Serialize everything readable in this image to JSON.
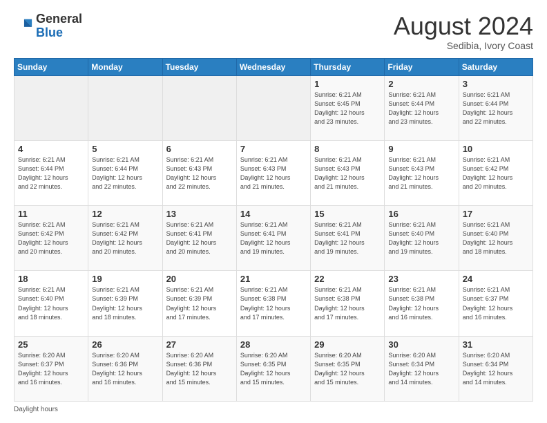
{
  "header": {
    "logo_general": "General",
    "logo_blue": "Blue",
    "month_year": "August 2024",
    "location": "Sedibia, Ivory Coast"
  },
  "footer": {
    "daylight_label": "Daylight hours"
  },
  "days_of_week": [
    "Sunday",
    "Monday",
    "Tuesday",
    "Wednesday",
    "Thursday",
    "Friday",
    "Saturday"
  ],
  "weeks": [
    [
      {
        "day": "",
        "info": ""
      },
      {
        "day": "",
        "info": ""
      },
      {
        "day": "",
        "info": ""
      },
      {
        "day": "",
        "info": ""
      },
      {
        "day": "1",
        "info": "Sunrise: 6:21 AM\nSunset: 6:45 PM\nDaylight: 12 hours\nand 23 minutes."
      },
      {
        "day": "2",
        "info": "Sunrise: 6:21 AM\nSunset: 6:44 PM\nDaylight: 12 hours\nand 23 minutes."
      },
      {
        "day": "3",
        "info": "Sunrise: 6:21 AM\nSunset: 6:44 PM\nDaylight: 12 hours\nand 22 minutes."
      }
    ],
    [
      {
        "day": "4",
        "info": "Sunrise: 6:21 AM\nSunset: 6:44 PM\nDaylight: 12 hours\nand 22 minutes."
      },
      {
        "day": "5",
        "info": "Sunrise: 6:21 AM\nSunset: 6:44 PM\nDaylight: 12 hours\nand 22 minutes."
      },
      {
        "day": "6",
        "info": "Sunrise: 6:21 AM\nSunset: 6:43 PM\nDaylight: 12 hours\nand 22 minutes."
      },
      {
        "day": "7",
        "info": "Sunrise: 6:21 AM\nSunset: 6:43 PM\nDaylight: 12 hours\nand 21 minutes."
      },
      {
        "day": "8",
        "info": "Sunrise: 6:21 AM\nSunset: 6:43 PM\nDaylight: 12 hours\nand 21 minutes."
      },
      {
        "day": "9",
        "info": "Sunrise: 6:21 AM\nSunset: 6:43 PM\nDaylight: 12 hours\nand 21 minutes."
      },
      {
        "day": "10",
        "info": "Sunrise: 6:21 AM\nSunset: 6:42 PM\nDaylight: 12 hours\nand 20 minutes."
      }
    ],
    [
      {
        "day": "11",
        "info": "Sunrise: 6:21 AM\nSunset: 6:42 PM\nDaylight: 12 hours\nand 20 minutes."
      },
      {
        "day": "12",
        "info": "Sunrise: 6:21 AM\nSunset: 6:42 PM\nDaylight: 12 hours\nand 20 minutes."
      },
      {
        "day": "13",
        "info": "Sunrise: 6:21 AM\nSunset: 6:41 PM\nDaylight: 12 hours\nand 20 minutes."
      },
      {
        "day": "14",
        "info": "Sunrise: 6:21 AM\nSunset: 6:41 PM\nDaylight: 12 hours\nand 19 minutes."
      },
      {
        "day": "15",
        "info": "Sunrise: 6:21 AM\nSunset: 6:41 PM\nDaylight: 12 hours\nand 19 minutes."
      },
      {
        "day": "16",
        "info": "Sunrise: 6:21 AM\nSunset: 6:40 PM\nDaylight: 12 hours\nand 19 minutes."
      },
      {
        "day": "17",
        "info": "Sunrise: 6:21 AM\nSunset: 6:40 PM\nDaylight: 12 hours\nand 18 minutes."
      }
    ],
    [
      {
        "day": "18",
        "info": "Sunrise: 6:21 AM\nSunset: 6:40 PM\nDaylight: 12 hours\nand 18 minutes."
      },
      {
        "day": "19",
        "info": "Sunrise: 6:21 AM\nSunset: 6:39 PM\nDaylight: 12 hours\nand 18 minutes."
      },
      {
        "day": "20",
        "info": "Sunrise: 6:21 AM\nSunset: 6:39 PM\nDaylight: 12 hours\nand 17 minutes."
      },
      {
        "day": "21",
        "info": "Sunrise: 6:21 AM\nSunset: 6:38 PM\nDaylight: 12 hours\nand 17 minutes."
      },
      {
        "day": "22",
        "info": "Sunrise: 6:21 AM\nSunset: 6:38 PM\nDaylight: 12 hours\nand 17 minutes."
      },
      {
        "day": "23",
        "info": "Sunrise: 6:21 AM\nSunset: 6:38 PM\nDaylight: 12 hours\nand 16 minutes."
      },
      {
        "day": "24",
        "info": "Sunrise: 6:21 AM\nSunset: 6:37 PM\nDaylight: 12 hours\nand 16 minutes."
      }
    ],
    [
      {
        "day": "25",
        "info": "Sunrise: 6:20 AM\nSunset: 6:37 PM\nDaylight: 12 hours\nand 16 minutes."
      },
      {
        "day": "26",
        "info": "Sunrise: 6:20 AM\nSunset: 6:36 PM\nDaylight: 12 hours\nand 16 minutes."
      },
      {
        "day": "27",
        "info": "Sunrise: 6:20 AM\nSunset: 6:36 PM\nDaylight: 12 hours\nand 15 minutes."
      },
      {
        "day": "28",
        "info": "Sunrise: 6:20 AM\nSunset: 6:35 PM\nDaylight: 12 hours\nand 15 minutes."
      },
      {
        "day": "29",
        "info": "Sunrise: 6:20 AM\nSunset: 6:35 PM\nDaylight: 12 hours\nand 15 minutes."
      },
      {
        "day": "30",
        "info": "Sunrise: 6:20 AM\nSunset: 6:34 PM\nDaylight: 12 hours\nand 14 minutes."
      },
      {
        "day": "31",
        "info": "Sunrise: 6:20 AM\nSunset: 6:34 PM\nDaylight: 12 hours\nand 14 minutes."
      }
    ]
  ]
}
